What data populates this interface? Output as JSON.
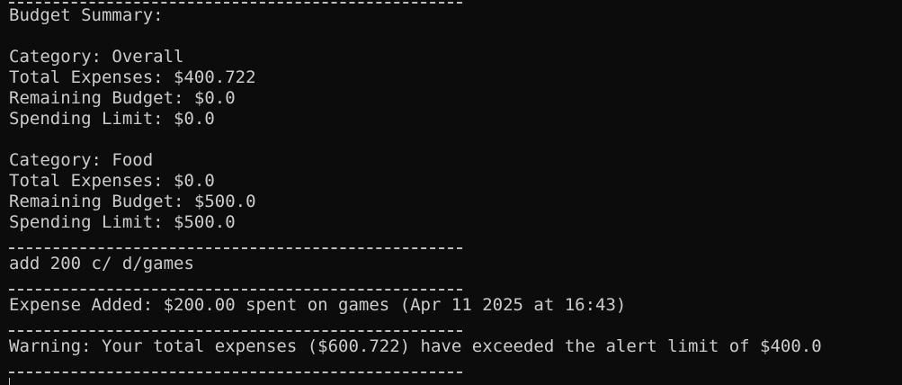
{
  "terminal": {
    "budget_summary_header": "Budget Summary:",
    "overall": {
      "category": "Category: Overall",
      "total_expenses": "Total Expenses: $400.722",
      "remaining_budget": "Remaining Budget: $0.0",
      "spending_limit": "Spending Limit: $0.0"
    },
    "food": {
      "category": "Category: Food",
      "total_expenses": "Total Expenses: $0.0",
      "remaining_budget": "Remaining Budget: $500.0",
      "spending_limit": "Spending Limit: $500.0"
    },
    "command": "add 200 c/ d/games",
    "expense_added": "Expense Added: $200.00 spent on games (Apr 11 2025 at 16:43)",
    "warning": "Warning: Your total expenses ($600.722) have exceeded the alert limit of $400.0"
  }
}
